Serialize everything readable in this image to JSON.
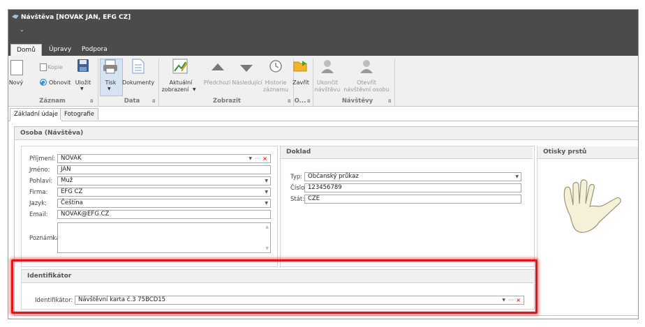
{
  "window": {
    "title": "Návštěva [NOVAK JAN, EFG CZ]"
  },
  "menu": {
    "tabs": [
      "Domů",
      "Úpravy",
      "Podpora"
    ]
  },
  "ribbon": {
    "novy": "Nový",
    "kopie": "Kopie",
    "obnovit": "Obnovit",
    "ulozit": "Uložit",
    "tisk": "Tisk",
    "dokumenty": "Dokumenty",
    "aktualni_1": "Aktuální",
    "aktualni_2": "zobrazení",
    "predchozi": "Předchozí",
    "nasledujici": "Následující",
    "historie_1": "Historie",
    "historie_2": "záznamu",
    "zavrit": "Zavřít",
    "ukoncit_1": "Ukončit",
    "ukoncit_2": "návštěvu",
    "otevrit_1": "Otevřít",
    "otevrit_2": "návštěvní osobu",
    "groups": {
      "zaznam": "Záznam",
      "data": "Data",
      "zobrazit": "Zobrazit",
      "o": "O...",
      "navstevy": "Návštěvy"
    }
  },
  "tabs": [
    "Základní údaje",
    "Fotografie"
  ],
  "osoba": {
    "title": "Osoba (Návštěva)",
    "prijmeni_label": "Příjmení:",
    "prijmeni": "NOVAK",
    "jmeno_label": "Jméno:",
    "jmeno": "JAN",
    "pohlavi_label": "Pohlaví:",
    "pohlavi": "Muž",
    "firma_label": "Firma:",
    "firma": "EFG CZ",
    "jazyk_label": "Jazyk:",
    "jazyk": "Čeština",
    "email_label": "Email:",
    "email": "NOVAK@EFG.CZ",
    "poznamka_label": "Poznámka:"
  },
  "doklad": {
    "title": "Doklad",
    "typ_label": "Typ:",
    "typ": "Občanský průkaz",
    "cislo_label": "Číslo:",
    "cislo": "123456789",
    "stat_label": "Stát:",
    "stat": "CZE"
  },
  "otisky": {
    "title": "Otisky prstů"
  },
  "identifikator": {
    "title": "Identifikátor",
    "label": "Identifikátor:",
    "value": "Návštěvní  karta  č.3  75BCD15"
  },
  "colors": {
    "highlight": "#e01515",
    "titlebar": "#4b4b4b"
  }
}
